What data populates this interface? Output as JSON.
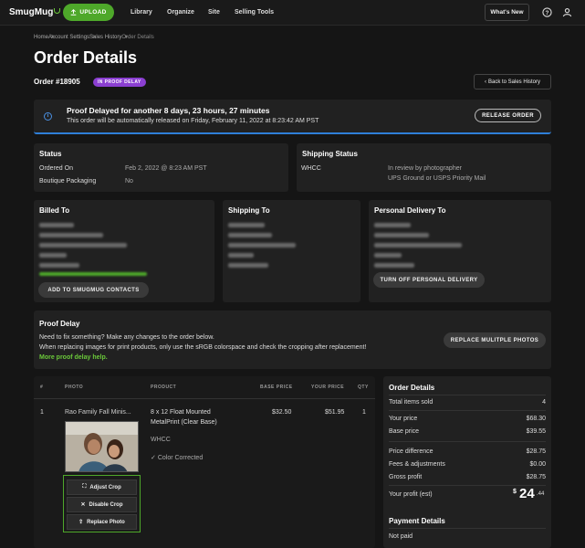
{
  "header": {
    "logo": "SmugMug",
    "upload_label": "UPLOAD",
    "nav": [
      "Library",
      "Organize",
      "Site",
      "Selling Tools"
    ],
    "whats_new": "What's New"
  },
  "breadcrumb": [
    "Home",
    "Account Settings",
    "Sales History",
    "Order Details"
  ],
  "page": {
    "title": "Order Details",
    "order_number": "Order #18905",
    "badge": "IN PROOF DELAY",
    "back_button": "Back to Sales History"
  },
  "banner": {
    "heading": "Proof Delayed for another 8 days, 23 hours, 27 minutes",
    "subtext": "This order will be automatically released on Friday, February 11, 2022 at 8:23:42 AM PST",
    "release_button": "RELEASE ORDER"
  },
  "status": {
    "title": "Status",
    "rows": [
      {
        "label": "Ordered On",
        "value": "Feb 2, 2022 @ 8:23 AM PST"
      },
      {
        "label": "Boutique Packaging",
        "value": "No"
      }
    ]
  },
  "shipping_status": {
    "title": "Shipping Status",
    "carrier": "WHCC",
    "line1": "In review by photographer",
    "line2": "UPS Ground or USPS Priority Mail"
  },
  "billed_to": {
    "title": "Billed To",
    "button": "ADD TO SMUGMUG CONTACTS"
  },
  "shipping_to": {
    "title": "Shipping To"
  },
  "personal_delivery": {
    "title": "Personal Delivery To",
    "button": "TURN OFF PERSONAL DELIVERY"
  },
  "proof_delay": {
    "title": "Proof Delay",
    "line1": "Need to fix something? Make any changes to the order below.",
    "line2": "When replacing images for print products, only use the sRGB colorspace and check the cropping after replacement!",
    "link": "More proof delay help.",
    "button": "REPLACE MULITPLE PHOTOS"
  },
  "table": {
    "headers": [
      "#",
      "PHOTO",
      "PRODUCT",
      "BASE PRICE",
      "YOUR PRICE",
      "QTY"
    ],
    "row": {
      "index": "1",
      "photo_name": "Rao Family Fall Minis...",
      "product_line1": "8 x 12 Float Mounted",
      "product_line2": "MetalPrint (Clear Base)",
      "vendor": "WHCC",
      "color": "Color Corrected",
      "base_price": "$32.50",
      "your_price": "$51.95",
      "qty": "1"
    },
    "actions": [
      "Adjust Crop",
      "Disable Crop",
      "Replace Photo"
    ]
  },
  "summary": {
    "title": "Order Details",
    "rows": [
      {
        "label": "Total items sold",
        "value": "4"
      },
      {
        "label": "Your price",
        "value": "$68.30"
      },
      {
        "label": "Base price",
        "value": "$39.55"
      },
      {
        "label": "Price difference",
        "value": "$28.75"
      },
      {
        "label": "Fees & adjustments",
        "value": "$0.00"
      },
      {
        "label": "Gross profit",
        "value": "$28.75"
      }
    ],
    "profit_label": "Your profit (est)",
    "profit_currency": "$",
    "profit_whole": "24",
    "profit_cents": ".44",
    "payment_title": "Payment Details",
    "payment_status": "Not paid"
  },
  "colors": {
    "accent": "#4ea82a",
    "badge": "#8b3fd1",
    "info": "#2f7fd8"
  }
}
